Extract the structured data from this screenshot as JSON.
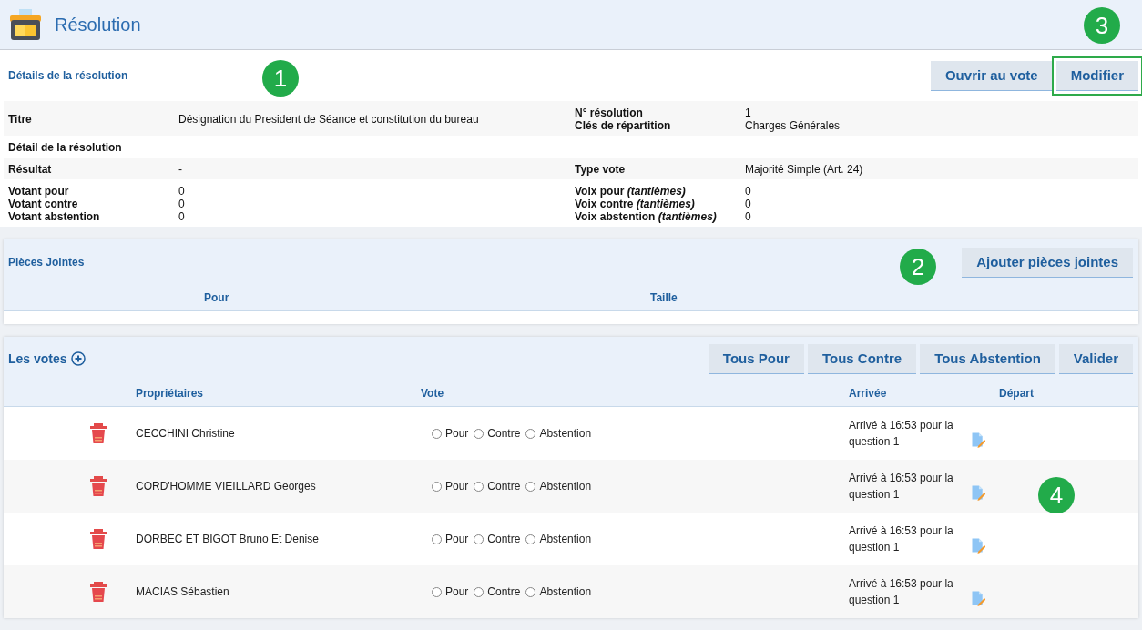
{
  "header": {
    "title": "Résolution"
  },
  "details": {
    "title": "Détails de la résolution",
    "buttons": [
      {
        "label": "Ouvrir au vote",
        "highlighted": false
      },
      {
        "label": "Modifier",
        "highlighted": true
      }
    ],
    "rows": [
      {
        "left": [
          {
            "label": "Titre",
            "value": "Désignation du President de Séance et constitution du bureau"
          }
        ],
        "right": [
          {
            "label": "N° résolution",
            "value": "1"
          },
          {
            "label": "Clés de répartition",
            "value": "Charges Générales"
          }
        ]
      },
      {
        "left": [
          {
            "label": "Détail de la résolution"
          }
        ],
        "right": []
      },
      {
        "left": [
          {
            "label": "Résultat",
            "value": "-"
          }
        ],
        "right": [
          {
            "label": "Type vote",
            "value": "Majorité Simple (Art. 24)"
          }
        ]
      },
      {
        "left": [
          {
            "label": "Votant pour",
            "value": "0"
          },
          {
            "label": "Votant contre",
            "value": "0"
          },
          {
            "label": "Votant abstention",
            "value": "0"
          }
        ],
        "right": [
          {
            "label": "Voix pour *(tantièmes)*",
            "value": "0"
          },
          {
            "label": "Voix contre *(tantièmes)*",
            "value": "0"
          },
          {
            "label": "Voix abstention *(tantièmes)*",
            "value": "0"
          }
        ]
      }
    ]
  },
  "attachments": {
    "title": "Pièces Jointes",
    "button": "Ajouter pièces jointes",
    "columns": [
      "Pour",
      "Taille"
    ]
  },
  "votes": {
    "title": "Les votes",
    "buttons": [
      "Tous Pour",
      "Tous Contre",
      "Tous Abstention",
      "Valider"
    ],
    "columns": [
      "Propriétaires",
      "Vote",
      "Arrivée",
      "Départ"
    ],
    "rows": [
      {
        "name": "CECCHINI Christine",
        "options": [
          {
            "label": "Pour",
            "selected": false
          },
          {
            "label": "Contre",
            "selected": false
          },
          {
            "label": "Abstention",
            "selected": false
          }
        ],
        "arrival": "Arrivé à 16:53 pour la question 1"
      },
      {
        "name": "CORD'HOMME VIEILLARD Georges",
        "options": [
          {
            "label": "Pour",
            "selected": false
          },
          {
            "label": "Contre",
            "selected": false
          },
          {
            "label": "Abstention",
            "selected": false
          }
        ],
        "arrival": "Arrivé à 16:53 pour la question 1"
      },
      {
        "name": "DORBEC ET BIGOT Bruno Et Denise",
        "options": [
          {
            "label": "Pour",
            "selected": false
          },
          {
            "label": "Contre",
            "selected": false
          },
          {
            "label": "Abstention",
            "selected": false
          }
        ],
        "arrival": "Arrivé à 16:53 pour la question 1"
      },
      {
        "name": "MACIAS Sébastien",
        "options": [
          {
            "label": "Pour",
            "selected": false
          },
          {
            "label": "Contre",
            "selected": false
          },
          {
            "label": "Abstention",
            "selected": false
          }
        ],
        "arrival": "Arrivé à 16:53 pour la question 1"
      }
    ]
  },
  "callouts": [
    "1",
    "2",
    "3",
    "4"
  ]
}
